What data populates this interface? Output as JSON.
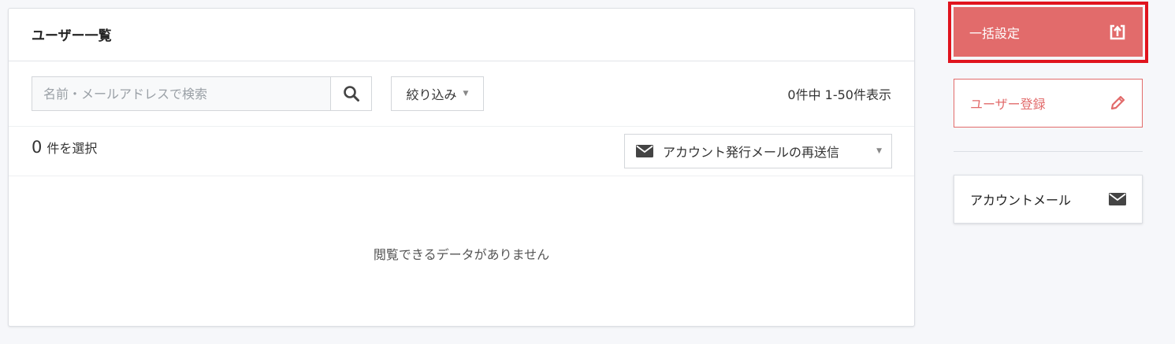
{
  "panel": {
    "title": "ユーザー一覧",
    "search": {
      "placeholder": "名前・メールアドレスで検索",
      "value": ""
    },
    "filter_label": "絞り込み",
    "count_text": "0件中 1-50件表示",
    "selected_count": "0",
    "selected_label": "件を選択",
    "resend_label": "アカウント発行メールの再送信",
    "empty_message": "閲覧できるデータがありません"
  },
  "sidebar": {
    "bulk_label": "一括設定",
    "register_label": "ユーザー登録",
    "account_mail_label": "アカウントメール"
  },
  "icons": {
    "search": "search-icon",
    "caret": "caret-down-icon",
    "mail": "envelope-icon",
    "upload": "upload-icon",
    "pencil": "pencil-icon"
  },
  "colors": {
    "accent": "#e26b6b",
    "highlight_frame": "#e0141e",
    "background": "#f6f7fa"
  }
}
